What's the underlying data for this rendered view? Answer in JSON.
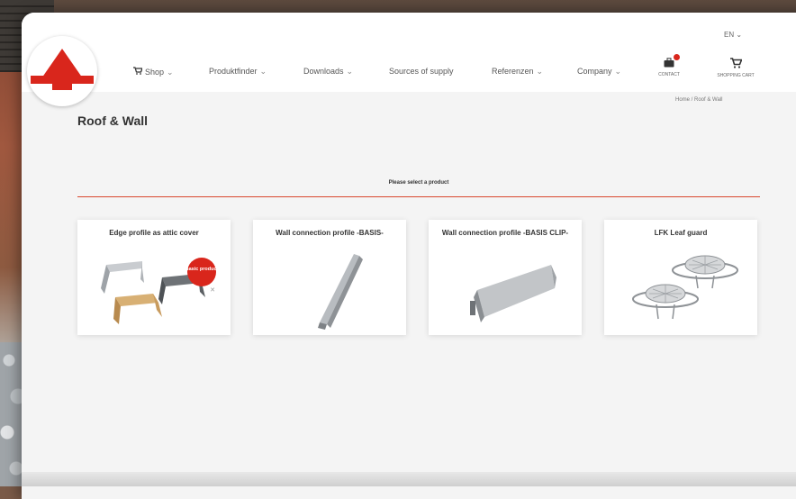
{
  "header": {
    "language": "EN",
    "nav": [
      {
        "label": "Shop",
        "has_dropdown": true,
        "icon": "cart-icon"
      },
      {
        "label": "Produktfinder",
        "has_dropdown": true
      },
      {
        "label": "Downloads",
        "has_dropdown": true
      },
      {
        "label": "Sources of supply",
        "has_dropdown": false
      },
      {
        "label": "Referenzen",
        "has_dropdown": true
      },
      {
        "label": "Company",
        "has_dropdown": true
      }
    ],
    "utility": [
      {
        "label": "CONTACT",
        "icon": "briefcase-icon"
      },
      {
        "label": "SHOPPING CART",
        "icon": "cart-icon"
      }
    ],
    "chevron": "⌄"
  },
  "breadcrumb": "Home  /  Roof & Wall",
  "page_title": "Roof & Wall",
  "select_prompt": "Please select a product",
  "products": [
    {
      "title": "Edge profile as attic cover",
      "badge": "Basic product"
    },
    {
      "title": "Wall connection profile -BASIS-"
    },
    {
      "title": "Wall connection profile -BASIS CLIP-"
    },
    {
      "title": "LFK Leaf guard"
    }
  ],
  "colors": {
    "accent": "#d9261c",
    "divider": "#d9492f"
  }
}
